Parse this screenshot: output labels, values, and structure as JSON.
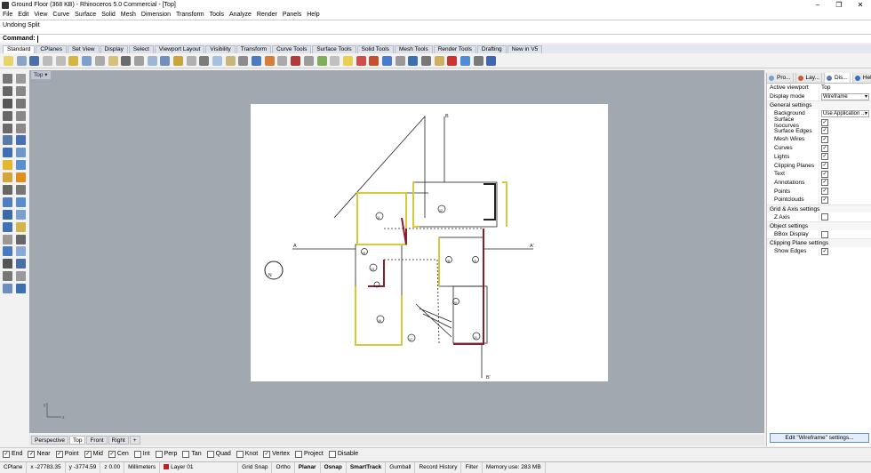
{
  "window": {
    "title": "Ground Floor (368 KB) - Rhinoceros 5.0 Commercial - [Top]",
    "controls": [
      "–",
      "❐",
      "✕"
    ]
  },
  "menu": [
    "File",
    "Edit",
    "View",
    "Curve",
    "Surface",
    "Solid",
    "Mesh",
    "Dimension",
    "Transform",
    "Tools",
    "Analyze",
    "Render",
    "Panels",
    "Help"
  ],
  "command": {
    "history": "Undoing Split",
    "prompt": "Command:"
  },
  "toolbar_tabs": [
    "Standard",
    "CPlanes",
    "Set View",
    "Display",
    "Select",
    "Viewport Layout",
    "Visibility",
    "Transform",
    "Curve Tools",
    "Surface Tools",
    "Solid Tools",
    "Mesh Tools",
    "Render Tools",
    "Drafting",
    "New in V5"
  ],
  "toolbar_colors": [
    "#e8d36a",
    "#8aa4c8",
    "#4b6fa8",
    "#bbbbbb",
    "#bcbcbc",
    "#d5b441",
    "#7f9fcf",
    "#aaaaaa",
    "#d6c07b",
    "#6b6b6b",
    "#a0a0a0",
    "#9fb5d6",
    "#6f8fbf",
    "#c8a43c",
    "#b0b0b0",
    "#7b7b7b",
    "#a5c0e0",
    "#c9b47a",
    "#8c8c8c",
    "#4c7ac0",
    "#d87c3a",
    "#aaaaaa",
    "#b13a3a",
    "#9c9c9c",
    "#7fae5a",
    "#c0c0c0",
    "#e9cf4d",
    "#d34c4c",
    "#c64f2e",
    "#4a7bd0",
    "#999999",
    "#3a6fb0",
    "#777777",
    "#d0b060",
    "#cc3333",
    "#4c8cd8",
    "#7a7a7a",
    "#3f66b0"
  ],
  "left_colors": [
    "#777777",
    "#999999",
    "#666666",
    "#888888",
    "#555555",
    "#777777",
    "#666666",
    "#888888",
    "#6a6a6a",
    "#8a8a8a",
    "#5a7aa8",
    "#4a70b0",
    "#3e6eb6",
    "#6c98cc",
    "#e6b62f",
    "#5c8fcf",
    "#d4a437",
    "#e0901a",
    "#666666",
    "#777777",
    "#4f7fc0",
    "#5a8dcc",
    "#3a6aa8",
    "#7aa0d0",
    "#3f70b8",
    "#d6b44c",
    "#999999",
    "#666666",
    "#4c7ac0",
    "#8aaad6",
    "#555555",
    "#4a6fa8",
    "#777777",
    "#999999",
    "#6a8fc0",
    "#3d6fb4"
  ],
  "viewport": {
    "label": "Top",
    "tabs": [
      "Perspective",
      "Top",
      "Front",
      "Right",
      "+"
    ],
    "active_tab": "Top"
  },
  "drawing": {
    "rooms": [
      "11",
      "12",
      "13",
      "15",
      "16",
      "17",
      "18",
      "19",
      "20",
      "21"
    ],
    "section_marks": [
      "B",
      "B'",
      "A",
      "A'"
    ],
    "north": "N"
  },
  "axis": {
    "x": "x",
    "y": "y"
  },
  "osnap": [
    {
      "label": "End",
      "checked": true
    },
    {
      "label": "Near",
      "checked": true
    },
    {
      "label": "Point",
      "checked": true
    },
    {
      "label": "Mid",
      "checked": true
    },
    {
      "label": "Cen",
      "checked": true
    },
    {
      "label": "Int",
      "checked": false
    },
    {
      "label": "Perp",
      "checked": false
    },
    {
      "label": "Tan",
      "checked": false
    },
    {
      "label": "Quad",
      "checked": false
    },
    {
      "label": "Knot",
      "checked": false
    },
    {
      "label": "Vertex",
      "checked": true
    },
    {
      "label": "Project",
      "checked": false
    },
    {
      "label": "Disable",
      "checked": false
    }
  ],
  "status": {
    "cplane": "CPlane",
    "x": "x -27783.35",
    "y": "y -3774.59",
    "z": "z 0.00",
    "units": "Millimeters",
    "layer": "Layer 01",
    "grid_snap": "Grid Snap",
    "ortho": "Ortho",
    "planar": "Planar",
    "osnap": "Osnap",
    "smarttrack": "SmartTrack",
    "gumball": "Gumball",
    "record": "Record History",
    "filter": "Filter",
    "memory": "Memory use: 283 MB"
  },
  "panel": {
    "tabs": [
      "Pro...",
      "Lay...",
      "Dis...",
      "Help"
    ],
    "rows_top": [
      {
        "k": "Active viewport",
        "v": "Top"
      },
      {
        "k": "Display mode",
        "v": "Wireframe"
      }
    ],
    "general": "General settings",
    "background": {
      "k": "Background",
      "v": "Use Application ..."
    },
    "checks": [
      {
        "k": "Surface Isocurves",
        "c": true
      },
      {
        "k": "Surface Edges",
        "c": true
      },
      {
        "k": "Mesh Wires",
        "c": true
      },
      {
        "k": "Curves",
        "c": true
      },
      {
        "k": "Lights",
        "c": true
      },
      {
        "k": "Clipping Planes",
        "c": true
      },
      {
        "k": "Text",
        "c": true
      },
      {
        "k": "Annotations",
        "c": true
      },
      {
        "k": "Points",
        "c": true
      },
      {
        "k": "Pointclouds",
        "c": true
      }
    ],
    "grid_title": "Grid & Axis settings",
    "zaxis": {
      "k": "Z Axis",
      "c": false
    },
    "obj_title": "Object settings",
    "bbox": {
      "k": "BBox Display",
      "c": false
    },
    "clip_title": "Clipping Plane settings",
    "showedges": {
      "k": "Show Edges",
      "c": true
    },
    "edit_button": "Edit \"Wireframe\" settings..."
  }
}
